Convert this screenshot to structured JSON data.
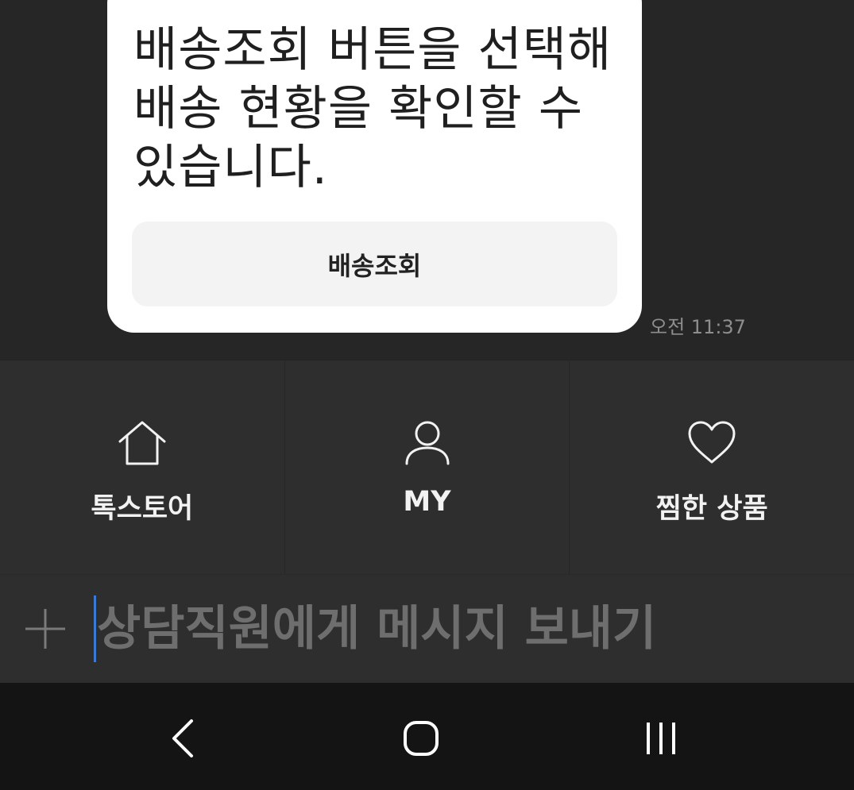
{
  "chat": {
    "message_lines": [
      "배송조회 버튼을 선택해",
      "배송 현황을 확인할 수",
      "있습니다."
    ],
    "button_label": "배송조회",
    "timestamp": "오전 11:37"
  },
  "quick_menu": {
    "items": [
      {
        "label": "톡스토어",
        "icon": "home-icon"
      },
      {
        "label": "MY",
        "icon": "person-icon"
      },
      {
        "label": "찜한 상품",
        "icon": "heart-icon"
      }
    ]
  },
  "input_bar": {
    "placeholder": "상담직원에게 메시지 보내기",
    "value": "",
    "add_icon": "plus-icon"
  },
  "nav_bar": {
    "icons": [
      "back-icon",
      "home-circle-icon",
      "recent-apps-icon"
    ]
  },
  "colors": {
    "background": "#262626",
    "panel": "#2e2e2e",
    "bubble": "#ffffff",
    "caret": "#3a7bd5",
    "nav": "#141414"
  }
}
